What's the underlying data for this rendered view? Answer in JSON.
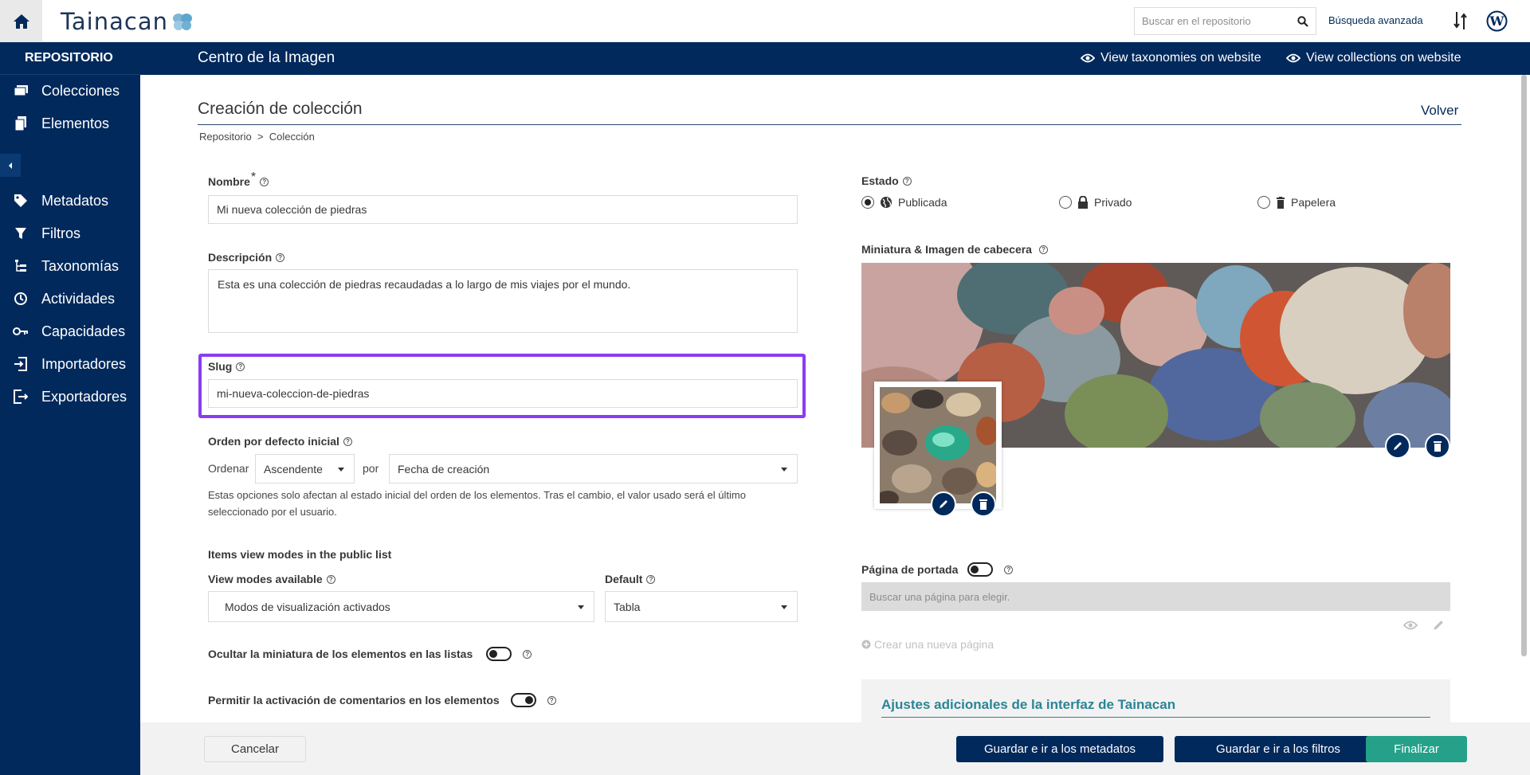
{
  "topbar": {
    "logo_text": "Tainacan",
    "search_placeholder": "Buscar en el repositorio",
    "advanced_search": "Búsqueda avanzada"
  },
  "sidebar": {
    "title": "REPOSITORIO",
    "items": [
      {
        "label": "Colecciones",
        "icon": "collections-icon"
      },
      {
        "label": "Elementos",
        "icon": "items-icon"
      },
      {
        "label": "Metadatos",
        "icon": "tag-icon"
      },
      {
        "label": "Filtros",
        "icon": "filter-icon"
      },
      {
        "label": "Taxonomías",
        "icon": "taxonomy-icon"
      },
      {
        "label": "Actividades",
        "icon": "activity-icon"
      },
      {
        "label": "Capacidades",
        "icon": "key-icon"
      },
      {
        "label": "Importadores",
        "icon": "import-icon"
      },
      {
        "label": "Exportadores",
        "icon": "export-icon"
      }
    ]
  },
  "header": {
    "title": "Centro de la Imagen",
    "view_taxonomies": "View taxonomies on website",
    "view_collections": "View collections on website"
  },
  "page": {
    "title": "Creación de colección",
    "back": "Volver",
    "breadcrumb": "Repositorio  >  Colección"
  },
  "form": {
    "name_label": "Nombre",
    "name_required": "*",
    "name_value": "Mi nueva colección de piedras",
    "description_label": "Descripción",
    "description_value": "Esta es una colección de piedras recaudadas a lo largo de mis viajes por el mundo.",
    "slug_label": "Slug",
    "slug_value": "mi-nueva-coleccion-de-piedras",
    "order_label": "Orden por defecto inicial",
    "order_prefix": "Ordenar",
    "order_direction": "Ascendente",
    "order_by_word": "por",
    "order_field": "Fecha de creación",
    "order_note": "Estas opciones solo afectan al estado inicial del orden de los elementos. Tras el cambio, el valor usado será el último seleccionado por el usuario.",
    "view_modes_section": "Items view modes in the public list",
    "view_modes_label": "View modes available",
    "view_modes_value": "Modos de visualización activados",
    "default_label": "Default",
    "default_value": "Tabla",
    "hide_thumb_label": "Ocultar la miniatura de los elementos en las listas",
    "hide_thumb_on": false,
    "comments_label": "Permitir la activación de comentarios en los elementos",
    "comments_on": true
  },
  "status": {
    "label": "Estado",
    "options": [
      {
        "label": "Publicada",
        "selected": true,
        "icon": "globe-icon"
      },
      {
        "label": "Privado",
        "selected": false,
        "icon": "lock-icon"
      },
      {
        "label": "Papelera",
        "selected": false,
        "icon": "trash-icon"
      }
    ]
  },
  "media": {
    "label": "Miniatura & Imagen de cabecera"
  },
  "cover": {
    "label": "Página de portada",
    "enabled": false,
    "search_placeholder": "Buscar una página para elegir.",
    "create_page": "Crear una nueva página"
  },
  "extra": {
    "title": "Ajustes adicionales de la interfaz de Tainacan"
  },
  "footer": {
    "cancel": "Cancelar",
    "save_metadata": "Guardar e ir a los metadatos",
    "save_filters": "Guardar e ir a los filtros",
    "finish": "Finalizar"
  },
  "colors": {
    "navy": "#01295c",
    "green": "#25a189",
    "teal": "#298596",
    "highlight": "#8a3cf2"
  }
}
